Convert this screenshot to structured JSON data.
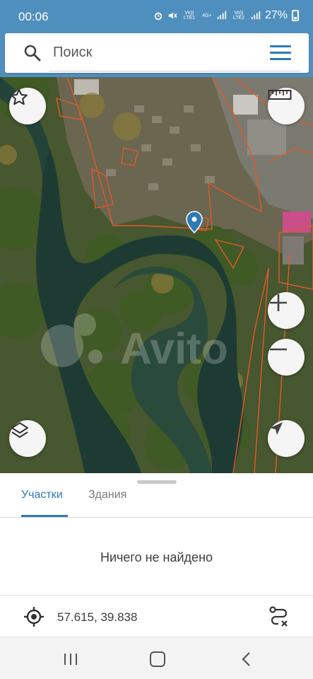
{
  "status_bar": {
    "time": "00:06",
    "sim1_label": "Vo)) LTE1",
    "net1": "4G+",
    "sim2_label": "Vo)) LTE2",
    "battery_percent": "27%"
  },
  "search": {
    "placeholder": "Поиск",
    "search_icon": "search-icon",
    "menu_icon": "hamburger-menu-icon"
  },
  "map": {
    "type": "satellite",
    "watermark": "Avito",
    "buttons": {
      "favorite_icon": "star-icon",
      "ruler_icon": "ruler-icon",
      "zoom_in_icon": "plus-icon",
      "zoom_out_icon": "minus-icon",
      "layers_icon": "layers-icon",
      "locate_icon": "navigation-arrow-icon"
    },
    "marker_icon": "map-pin-icon"
  },
  "panel": {
    "tabs": [
      {
        "label": "Участки",
        "active": true
      },
      {
        "label": "Здания",
        "active": false
      }
    ],
    "empty_message": "Ничего не найдено",
    "coordinates": "57.615, 39.838",
    "target_icon": "crosshair-icon",
    "route_icon": "route-clear-icon"
  },
  "colors": {
    "accent": "#2d7ab8",
    "status_bar": "#4f8fbe",
    "parcel_outline": "#e05a2b",
    "water": "#1e3b33"
  },
  "navbar": {
    "recent_icon": "recent-apps-icon",
    "home_icon": "home-icon",
    "back_icon": "back-icon"
  }
}
